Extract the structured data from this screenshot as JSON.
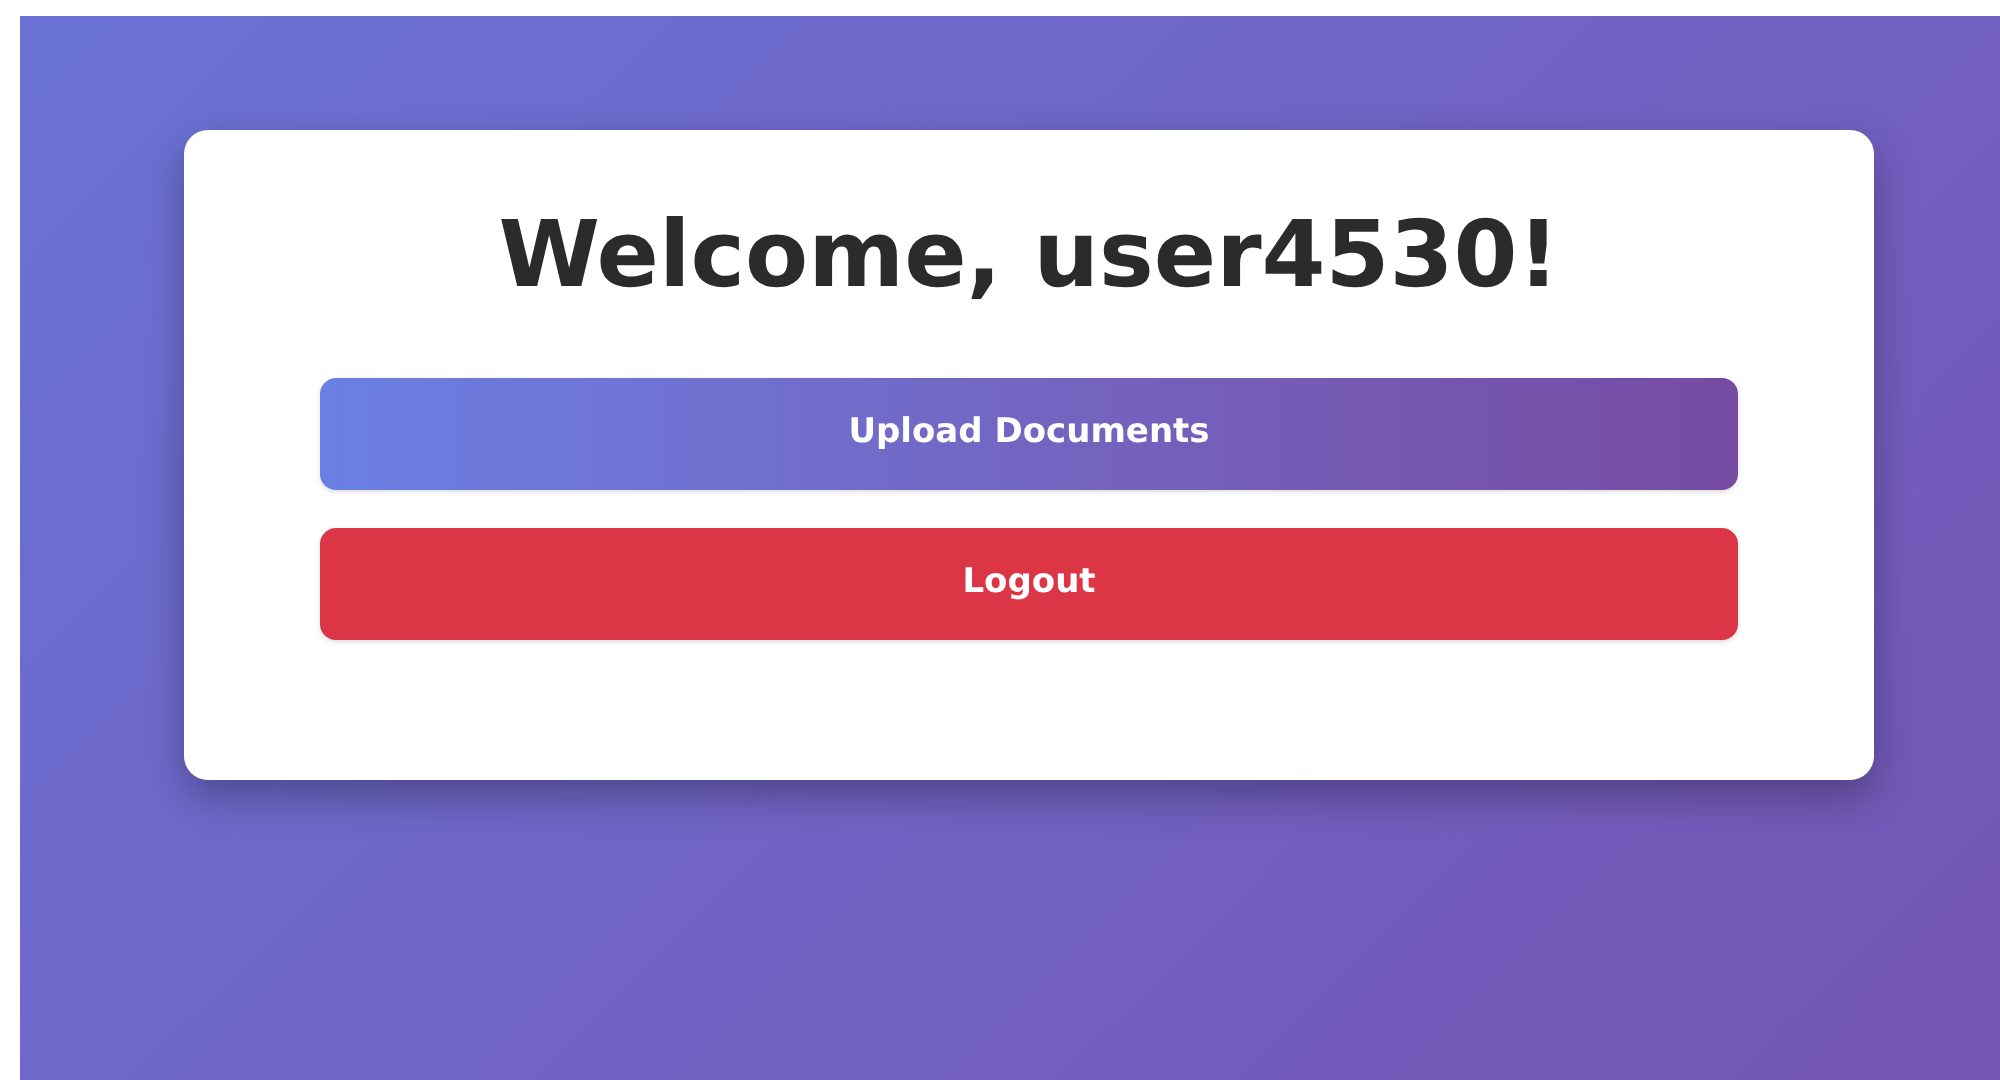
{
  "title": "Welcome, user4530!",
  "buttons": [
    {
      "label": "Upload Documents",
      "kind": "primary"
    },
    {
      "label": "Logout",
      "kind": "danger"
    }
  ]
}
